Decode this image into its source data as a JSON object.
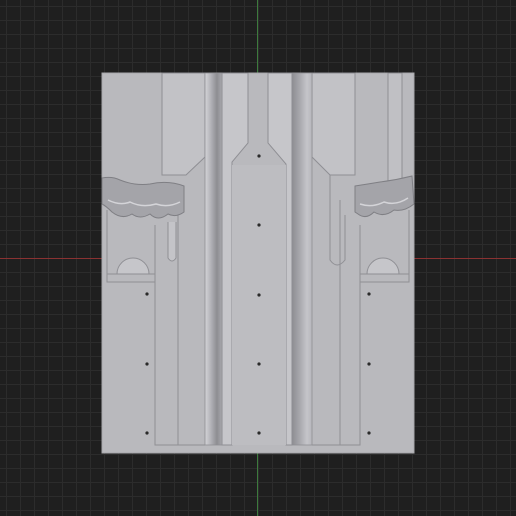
{
  "viewport": {
    "view": "3d-viewport",
    "background_color": "#1f1f1f",
    "grid_color": "#2c2c2c",
    "axis_x_color": "#8a3232",
    "axis_y_color": "#3d7a3d"
  },
  "model": {
    "object": "mold-half",
    "base_color": "#b9b9bd",
    "shadow_color": "#8f8f94",
    "highlight_color": "#d2d2d6",
    "pin_hole_count": 11
  }
}
